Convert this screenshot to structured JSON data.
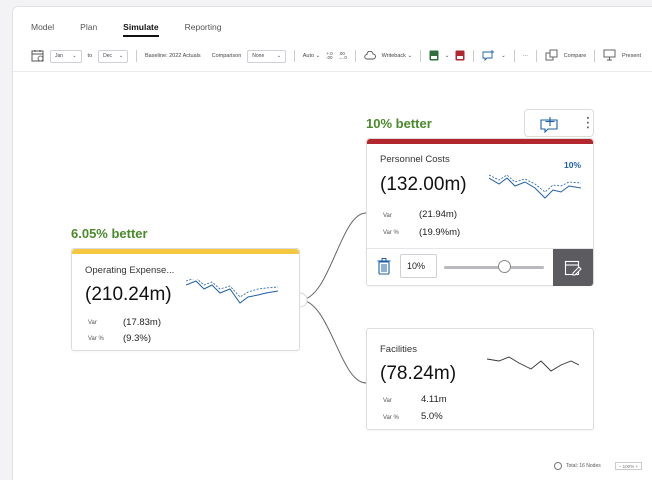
{
  "tabs": [
    {
      "label": "Model"
    },
    {
      "label": "Plan"
    },
    {
      "label": "Simulate"
    },
    {
      "label": "Reporting"
    }
  ],
  "toolbar": {
    "from_month": "Jan",
    "to_label": "to",
    "to_month": "Dec",
    "baseline": "Baseline: 2022 Actuals",
    "comparison_label": "Comparison",
    "comparison_value": "None",
    "auto_label": "Auto",
    "writeback_label": "Writeback",
    "compare_label": "Compare",
    "present_label": "Present"
  },
  "nodes": {
    "operating": {
      "better": "6.05% better",
      "name": "Operating Expense...",
      "value": "(210.24m)",
      "var_label": "Var",
      "var_value": "(17.83m)",
      "varpct_label": "Var %",
      "varpct_value": "(9.3%)"
    },
    "personnel": {
      "better": "10% better",
      "name": "Personnel Costs",
      "pct": "10%",
      "value": "(132.00m)",
      "var_label": "Var",
      "var_value": "(21.94m)",
      "varpct_label": "Var %",
      "varpct_value": "(19.9%m)",
      "input_value": "10%",
      "slider_fraction": 0.6
    },
    "facilities": {
      "name": "Facilities",
      "value": "(78.24m)",
      "var_label": "Var",
      "var_value": "4.11m",
      "varpct_label": "Var %",
      "varpct_value": "5.0%"
    }
  },
  "footer": {
    "total": "Total: 16 Nodes",
    "zoom": "100%"
  },
  "colors": {
    "better_green": "#4a8a2c",
    "operating_bar": "#f5c842",
    "personnel_bar": "#b3262d",
    "accent_blue": "#1f5fa8"
  }
}
